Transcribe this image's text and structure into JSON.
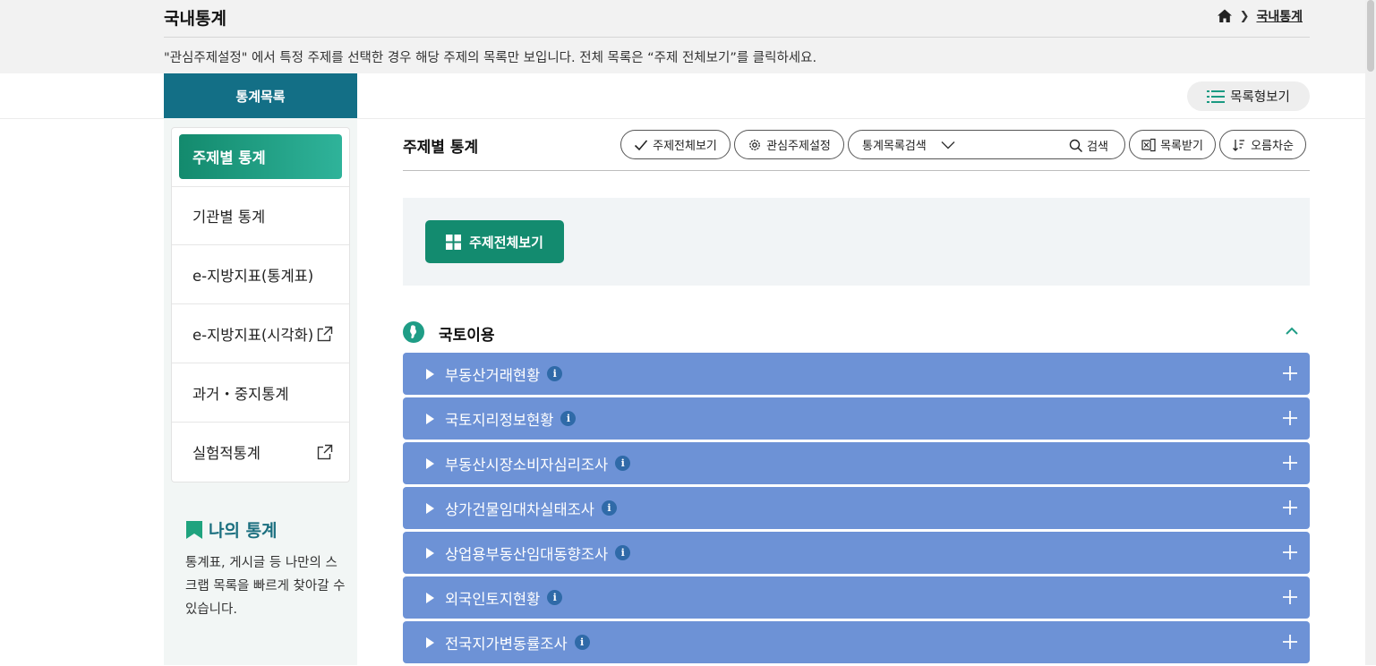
{
  "header": {
    "title": "국내통계",
    "breadcrumb": {
      "current": "국내통계"
    },
    "notice": "\"관심주제설정\" 에서 특정 주제를 선택한 경우 해당 주제의 목록만 보입니다. 전체 목록은 “주제 전체보기”를 클릭하세요."
  },
  "sidebar": {
    "heading": "통계목록",
    "items": [
      {
        "label": "주제별 통계",
        "active": true
      },
      {
        "label": "기관별 통계"
      },
      {
        "label": "e-지방지표(통계표)"
      },
      {
        "label": "e-지방지표(시각화)",
        "external": true
      },
      {
        "label": "과거・중지통계"
      },
      {
        "label": "실험적통계",
        "external": true
      }
    ],
    "my": {
      "title": "나의 통계",
      "desc": "통계표, 게시글 등 나만의 스크랩 목록을 빠르게 찾아갈 수 있습니다."
    }
  },
  "toolbar": {
    "view_toggle": "목록형보기",
    "section_title": "주제별 통계",
    "all_topics": "주제전체보기",
    "interest": "관심주제설정",
    "search_select": "통계목록검색",
    "search": "검색",
    "download": "목록받기",
    "sort": "오름차순"
  },
  "panel": {
    "button": "주제전체보기"
  },
  "category": {
    "name": "국토이용",
    "stats": [
      "부동산거래현황",
      "국토지리정보현황",
      "부동산시장소비자심리조사",
      "상가건물임대차실태조사",
      "상업용부동산임대동향조사",
      "외국인토지현황",
      "전국지가변동률조사"
    ]
  },
  "colors": {
    "sidebar_head": "#136f86",
    "accent_green": "#138b6f",
    "row_blue": "#6d92d6",
    "info_blue": "#2f6aa8"
  }
}
